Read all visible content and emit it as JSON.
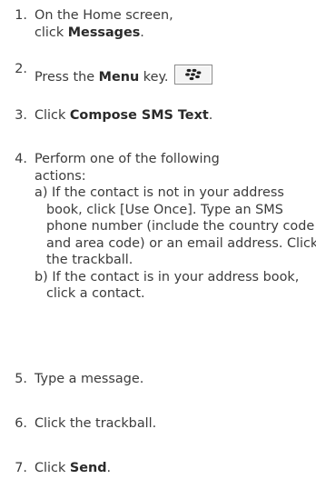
{
  "steps": [
    {
      "num": "1.",
      "line1": "On the Home screen,",
      "pre": "click ",
      "bold": "Messages",
      "post": "."
    },
    {
      "num": "2.",
      "pre": "Press the ",
      "bold": "Menu",
      "post": " key.",
      "icon": "blackberry-menu-key-icon"
    },
    {
      "num": "3.",
      "pre": "Click ",
      "bold": "Compose SMS Text",
      "post": "."
    },
    {
      "num": "4.",
      "line1": "Perform one of the following",
      "line2": "actions:",
      "a": "a) If the contact is not in your address book, click [Use Once]. Type an SMS phone number (include the country code and area code) or an email address. Click the trackball.",
      "b": "b) If the contact is in your address book, click a contact."
    },
    {
      "num": "5.",
      "text": "Type a message."
    },
    {
      "num": "6.",
      "text": "Click the trackball."
    },
    {
      "num": "7.",
      "pre": "Click ",
      "bold": "Send",
      "post": "."
    }
  ]
}
